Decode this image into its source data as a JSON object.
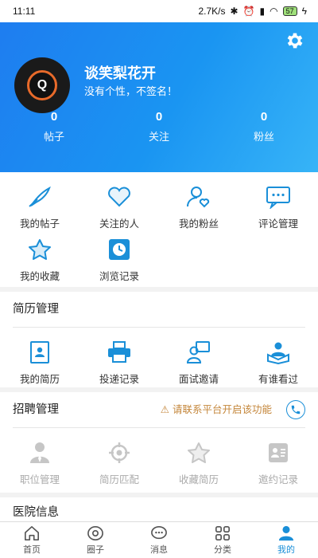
{
  "status": {
    "time": "11:11",
    "speed": "2.7K/s",
    "battery": "57"
  },
  "profile": {
    "avatar_letter": "Q",
    "name": "谈笑梨花开",
    "signature": "没有个性，不签名！",
    "stats": [
      {
        "value": "0",
        "label": "帖子"
      },
      {
        "value": "0",
        "label": "关注"
      },
      {
        "value": "0",
        "label": "粉丝"
      }
    ]
  },
  "quick": {
    "items": [
      {
        "label": "我的帖子",
        "icon": "feather-icon"
      },
      {
        "label": "关注的人",
        "icon": "heart-icon"
      },
      {
        "label": "我的粉丝",
        "icon": "user-heart-icon"
      },
      {
        "label": "评论管理",
        "icon": "comment-icon"
      },
      {
        "label": "我的收藏",
        "icon": "star-icon"
      },
      {
        "label": "浏览记录",
        "icon": "clock-icon"
      }
    ]
  },
  "resume": {
    "title": "简历管理",
    "items": [
      {
        "label": "我的简历",
        "icon": "resume-icon"
      },
      {
        "label": "投递记录",
        "icon": "printer-icon"
      },
      {
        "label": "面试邀请",
        "icon": "interview-icon"
      },
      {
        "label": "有谁看过",
        "icon": "viewer-icon"
      }
    ]
  },
  "recruit": {
    "title": "招聘管理",
    "warning": "请联系平台开启该功能",
    "items": [
      {
        "label": "职位管理",
        "icon": "person-tie-icon"
      },
      {
        "label": "简历匹配",
        "icon": "target-icon"
      },
      {
        "label": "收藏简历",
        "icon": "star-outline-icon"
      },
      {
        "label": "邀约记录",
        "icon": "card-icon"
      }
    ]
  },
  "hospital": {
    "title": "医院信息"
  },
  "tabbar": {
    "tabs": [
      {
        "label": "首页"
      },
      {
        "label": "圈子"
      },
      {
        "label": "消息"
      },
      {
        "label": "分类"
      },
      {
        "label": "我的"
      }
    ],
    "active": "我的"
  },
  "colors": {
    "primary": "#1a8fd8",
    "header_start": "#1e7df0",
    "header_end": "#37b4f7",
    "warning": "#c4863a"
  }
}
